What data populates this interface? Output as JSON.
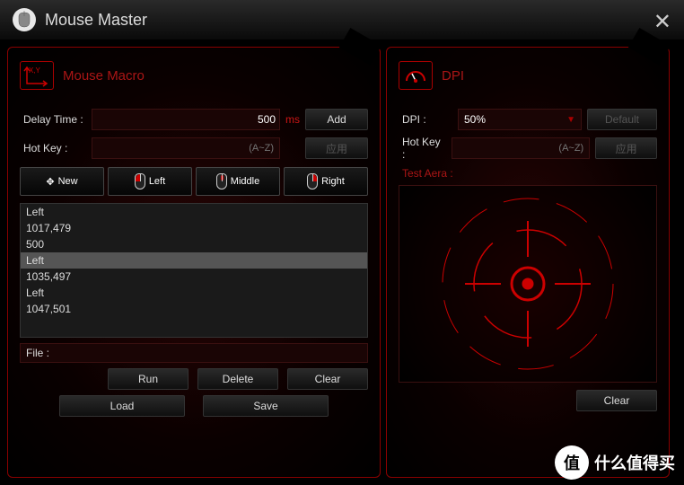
{
  "window": {
    "title": "Mouse Master"
  },
  "macro": {
    "title": "Mouse Macro",
    "icon_text": "X,Y",
    "delay_label": "Delay Time :",
    "delay_value": "500",
    "delay_unit": "ms",
    "add_label": "Add",
    "hotkey_label": "Hot Key :",
    "hotkey_hint": "(A~Z)",
    "apply_label": "应用",
    "tabs": [
      "New",
      "Left",
      "Middle",
      "Right"
    ],
    "list": [
      "Left",
      "1017,479",
      "500",
      "Left",
      "1035,497",
      "Left",
      "1047,501"
    ],
    "selected_index": 3,
    "file_label": "File :",
    "run_label": "Run",
    "delete_label": "Delete",
    "clear_label": "Clear",
    "load_label": "Load",
    "save_label": "Save"
  },
  "dpi": {
    "title": "DPI",
    "label": "DPI :",
    "value": "50%",
    "default_label": "Default",
    "hotkey_label": "Hot Key :",
    "hotkey_hint": "(A~Z)",
    "apply_label": "应用",
    "test_label": "Test Aera :",
    "clear_label": "Clear"
  },
  "watermark": {
    "badge": "值",
    "text": "什么值得买"
  }
}
